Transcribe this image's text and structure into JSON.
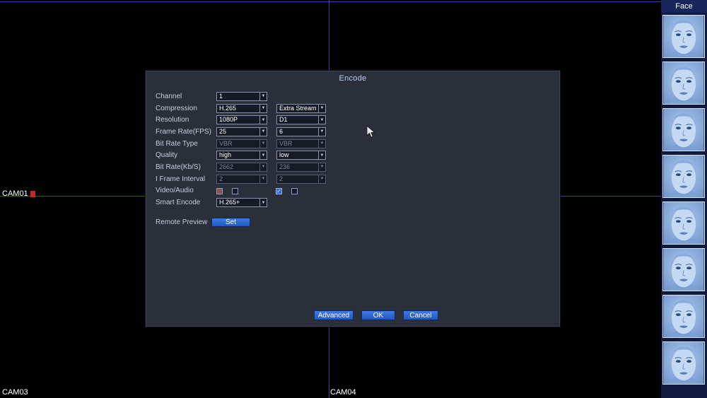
{
  "screen": {
    "cam01": "CAM01",
    "cam03": "CAM03",
    "cam04": "CAM04"
  },
  "sidebar": {
    "title": "Face",
    "thumbnail_count": 8
  },
  "dialog": {
    "title": "Encode",
    "rows": [
      {
        "label": "Channel",
        "v1": "1"
      },
      {
        "label": "Compression",
        "v1": "H.265",
        "v2": "Extra Stream"
      },
      {
        "label": "Resolution",
        "v1": "1080P",
        "v2": "D1"
      },
      {
        "label": "Frame Rate(FPS)",
        "v1": "25",
        "v2": "6"
      },
      {
        "label": "Bit Rate Type",
        "v1": "VBR",
        "v2": "VBR",
        "disabled": true
      },
      {
        "label": "Quality",
        "v1": "high",
        "v2": "low"
      },
      {
        "label": "Bit Rate(Kb/S)",
        "v1": "2662",
        "v2": "236",
        "disabled": true
      },
      {
        "label": "I Frame Interval",
        "v1": "2",
        "v2": "2",
        "disabled": true
      },
      {
        "label": "Video/Audio"
      },
      {
        "label": "Smart Encode",
        "v1": "H.265+"
      }
    ],
    "checkboxes": {
      "main_video_checked": true,
      "main_audio_checked": false,
      "extra_video_checked": true,
      "extra_audio_checked": false
    },
    "remote_preview_label": "Remote Preview",
    "buttons": {
      "set": "Set",
      "advanced": "Advanced",
      "ok": "OK",
      "cancel": "Cancel"
    }
  },
  "icons": {
    "chevron_down": "▼",
    "check": "✓"
  },
  "colors": {
    "button_blue": "#2e6ad4",
    "grid_line": "#3e3e9c",
    "dialog_bg": "#2b2f3a",
    "sidebar_bg": "#101a3e",
    "record_red": "#c42a1e"
  }
}
